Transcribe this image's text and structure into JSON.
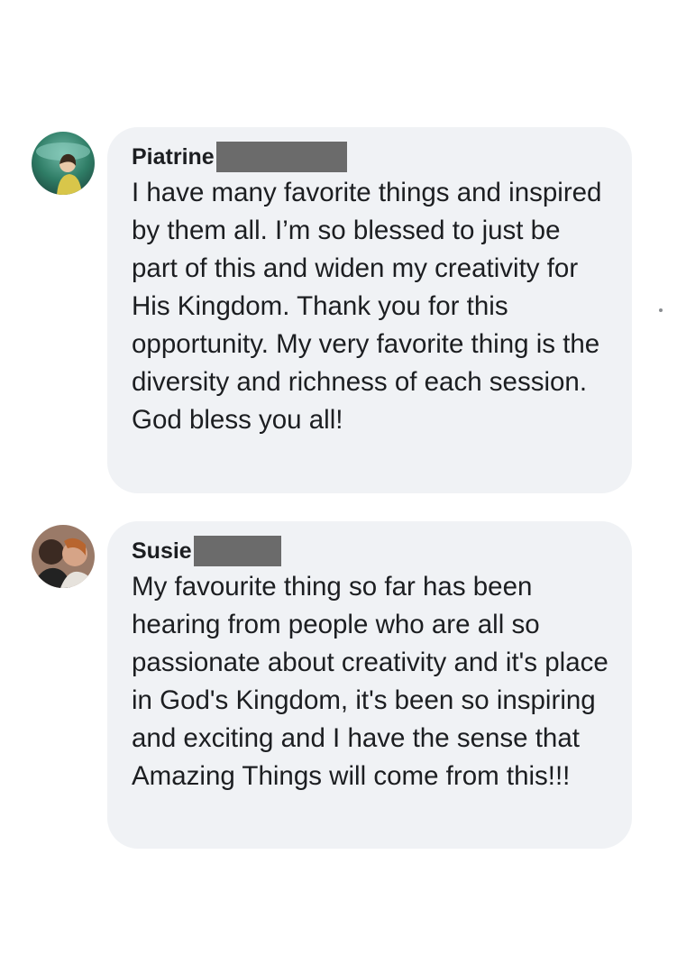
{
  "comments": [
    {
      "author": "Piatrine",
      "text": "I have many favorite things and inspired by them all. I’m so blessed to just be part of this and widen my creativity for His Kingdom. Thank you for this opportunity. My very favorite thing is the diversity and richness of each session. God bless you all!",
      "avatar_icon": "profile-photo-icon"
    },
    {
      "author": "Susie",
      "text": "My favourite thing so far has been hearing from people who are all so passionate about creativity and it's place in God's Kingdom, it's been so inspiring and exciting and I have the sense that Amazing Things will come from this!!!",
      "avatar_icon": "profile-photo-icon"
    }
  ],
  "colors": {
    "bubble": "#f0f2f5",
    "text": "#1c1e21",
    "redaction": "#6b6b6b"
  }
}
